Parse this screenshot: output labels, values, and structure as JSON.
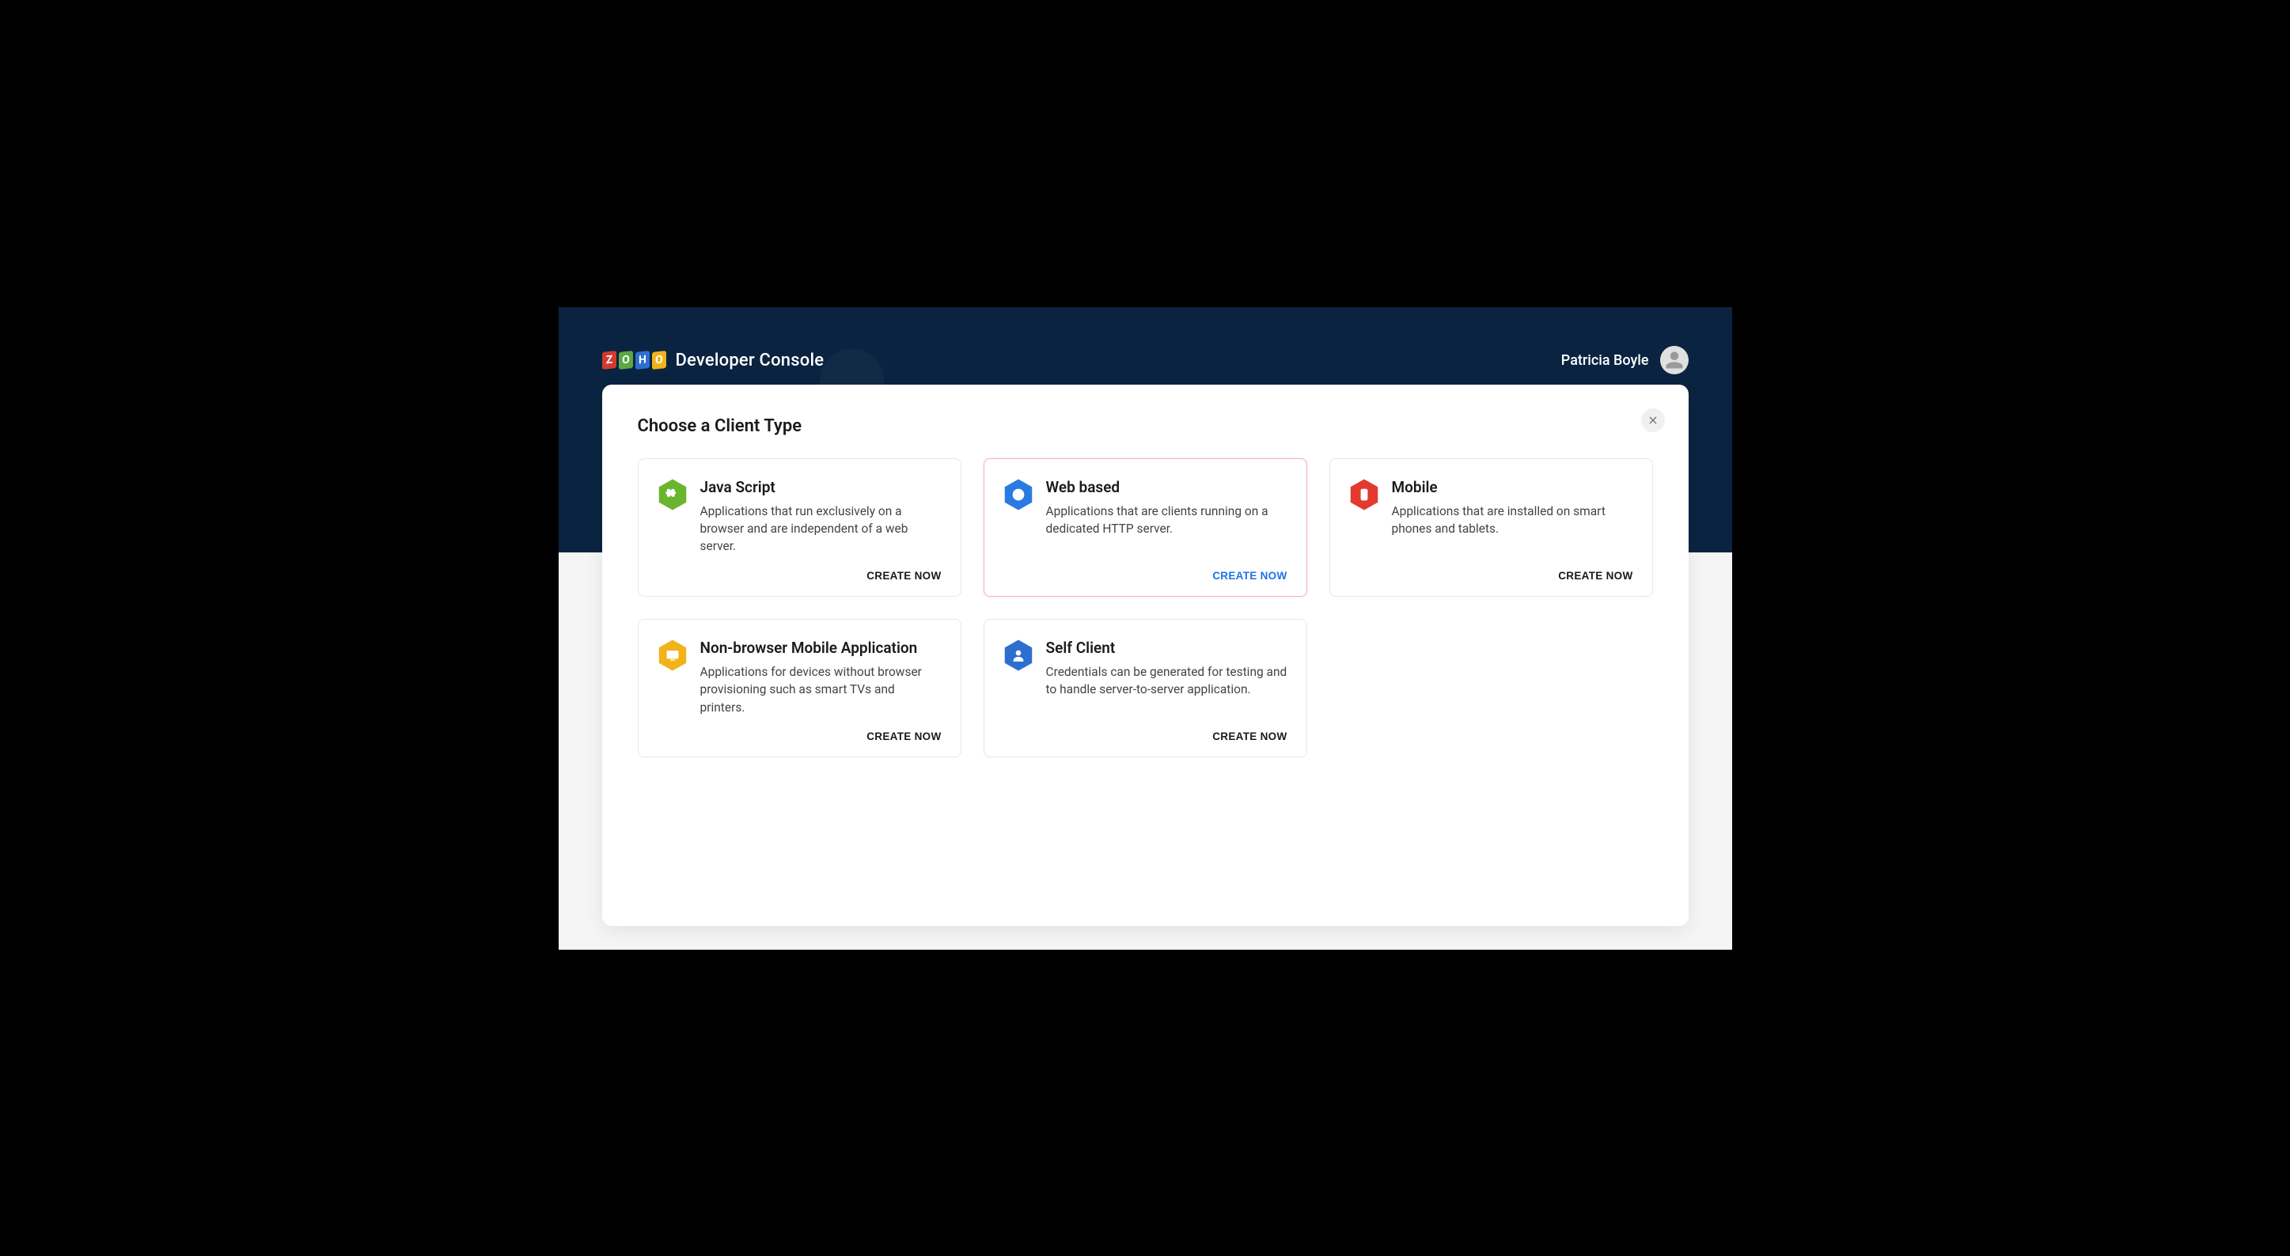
{
  "brand": {
    "logo_letters": [
      "Z",
      "O",
      "H",
      "O"
    ],
    "app_title": "Developer Console"
  },
  "user": {
    "name": "Patricia Boyle"
  },
  "panel": {
    "title": "Choose a Client Type"
  },
  "cards": [
    {
      "id": "javascript",
      "title": "Java Script",
      "description": "Applications that run exclusively on a browser and are independent of a web server.",
      "cta": "CREATE NOW",
      "color": "#6ab52e",
      "icon": "puzzle",
      "selected": false
    },
    {
      "id": "webbased",
      "title": "Web based",
      "description": "Applications that are clients running on a dedicated HTTP server.",
      "cta": "CREATE NOW",
      "color": "#2a7ae2",
      "icon": "globe",
      "selected": true
    },
    {
      "id": "mobile",
      "title": "Mobile",
      "description": "Applications that are installed on smart phones and tablets.",
      "cta": "CREATE NOW",
      "color": "#e23a2f",
      "icon": "phone",
      "selected": false
    },
    {
      "id": "nonbrowser",
      "title": "Non-browser Mobile Application",
      "description": "Applications for devices without browser provisioning such as smart TVs and printers.",
      "cta": "CREATE NOW",
      "color": "#f2b31a",
      "icon": "tv",
      "selected": false
    },
    {
      "id": "selfclient",
      "title": "Self Client",
      "description": "Credentials can be generated for testing and to handle server-to-server application.",
      "cta": "CREATE NOW",
      "color": "#2d6fd1",
      "icon": "person",
      "selected": false
    }
  ]
}
